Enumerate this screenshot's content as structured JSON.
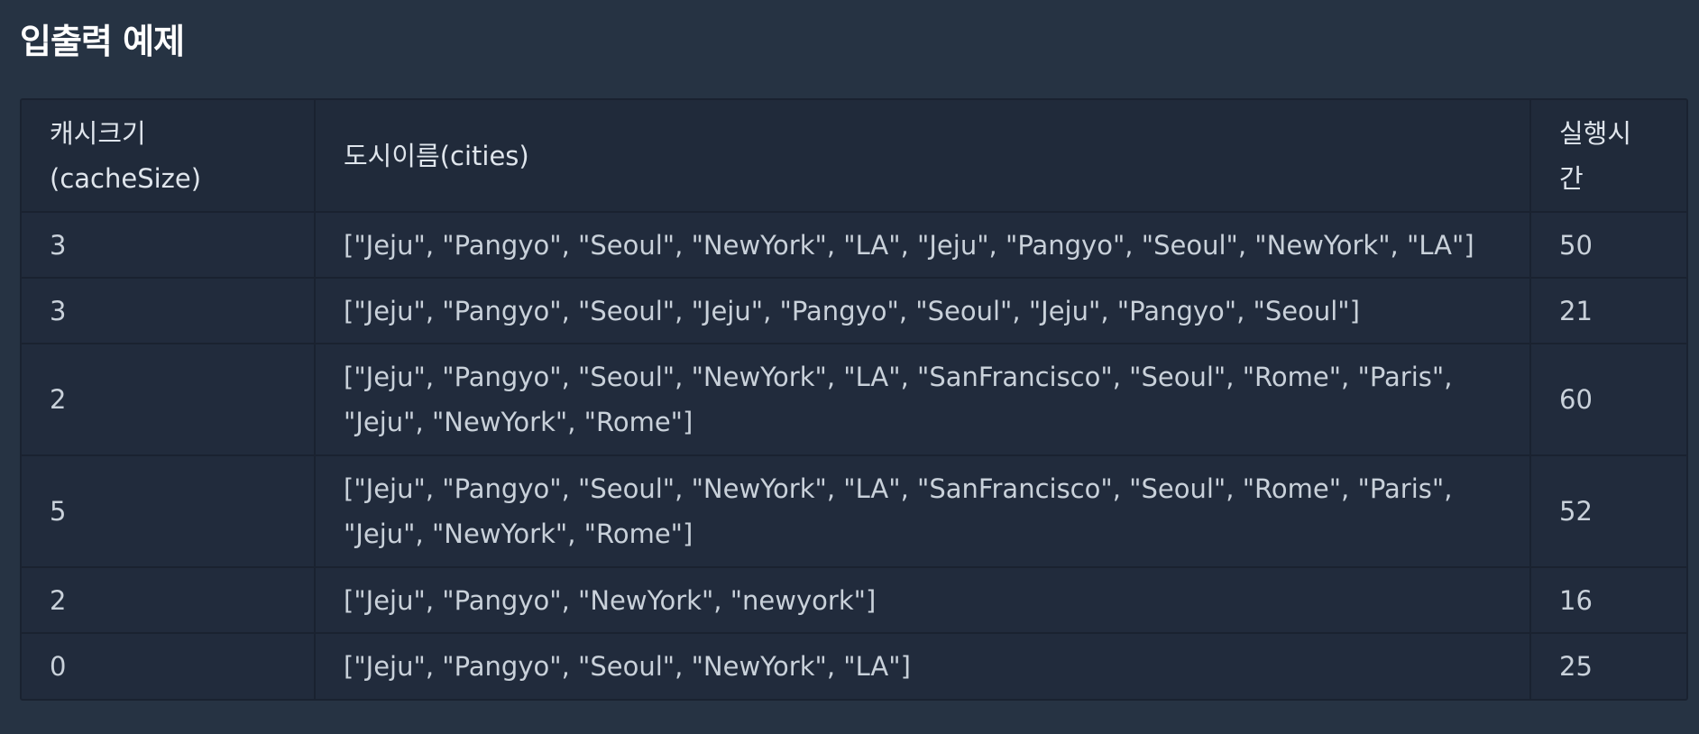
{
  "section_title": "입출력 예제",
  "table": {
    "headers": [
      [
        "캐시크기",
        "(cacheSize)"
      ],
      [
        "도시이름(cities)"
      ],
      [
        "실행시",
        "간"
      ]
    ],
    "rows": [
      {
        "cache_size": "3",
        "cities": [
          "[\"Jeju\", \"Pangyo\", \"Seoul\", \"NewYork\", \"LA\", \"Jeju\", \"Pangyo\", \"Seoul\", \"NewYork\", \"LA\"]"
        ],
        "time": "50"
      },
      {
        "cache_size": "3",
        "cities": [
          "[\"Jeju\", \"Pangyo\", \"Seoul\", \"Jeju\", \"Pangyo\", \"Seoul\", \"Jeju\", \"Pangyo\", \"Seoul\"]"
        ],
        "time": "21"
      },
      {
        "cache_size": "2",
        "cities": [
          "[\"Jeju\", \"Pangyo\", \"Seoul\", \"NewYork\", \"LA\", \"SanFrancisco\", \"Seoul\", \"Rome\", \"Paris\",",
          "\"Jeju\", \"NewYork\", \"Rome\"]"
        ],
        "time": "60"
      },
      {
        "cache_size": "5",
        "cities": [
          "[\"Jeju\", \"Pangyo\", \"Seoul\", \"NewYork\", \"LA\", \"SanFrancisco\", \"Seoul\", \"Rome\", \"Paris\",",
          "\"Jeju\", \"NewYork\", \"Rome\"]"
        ],
        "time": "52"
      },
      {
        "cache_size": "2",
        "cities": [
          "[\"Jeju\", \"Pangyo\", \"NewYork\", \"newyork\"]"
        ],
        "time": "16"
      },
      {
        "cache_size": "0",
        "cities": [
          "[\"Jeju\", \"Pangyo\", \"Seoul\", \"NewYork\", \"LA\"]"
        ],
        "time": "25"
      }
    ]
  },
  "colors": {
    "page_background": "#263343",
    "table_background": "#212b3c",
    "table_border": "#1a2230",
    "text": "#c9d1da",
    "title": "#ffffff"
  }
}
